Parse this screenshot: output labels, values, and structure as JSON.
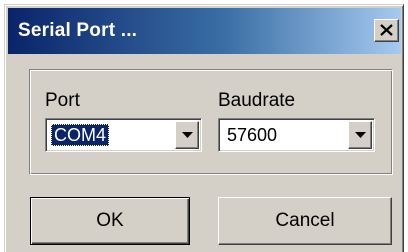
{
  "window": {
    "title": "Serial Port ...",
    "close_icon": "close-icon"
  },
  "port": {
    "label": "Port",
    "value": "COM4",
    "arrow_icon": "chevron-down-icon"
  },
  "baudrate": {
    "label": "Baudrate",
    "value": "57600",
    "arrow_icon": "chevron-down-icon"
  },
  "buttons": {
    "ok_label": "OK",
    "cancel_label": "Cancel"
  },
  "colors": {
    "title_gradient_start": "#0a246a",
    "title_gradient_end": "#a6caf0",
    "face": "#d4d0c8",
    "selection": "#0a246a"
  }
}
